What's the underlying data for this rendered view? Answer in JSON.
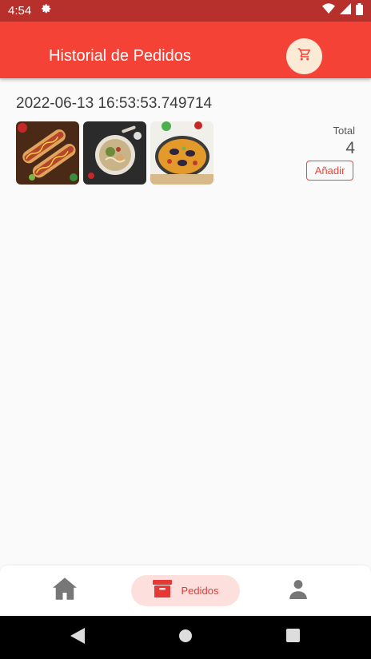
{
  "status_bar": {
    "time": "4:54",
    "icons": [
      "settings-icon",
      "wifi-icon",
      "cell-signal-icon",
      "battery-icon"
    ]
  },
  "app_bar": {
    "title": "Historial de Pedidos",
    "cart_icon": "cart-icon",
    "colors": {
      "background": "#f44336",
      "cart_button": "#fbead6"
    }
  },
  "orders": [
    {
      "date": "2022-06-13 16:53:53.749714",
      "images": [
        "hot-dogs-photo",
        "noodle-soup-photo",
        "paella-photo"
      ],
      "total_label": "Total",
      "total_value": "4",
      "add_label": "Añadir"
    }
  ],
  "bottom_nav": {
    "items": [
      {
        "icon": "home-icon",
        "label": ""
      },
      {
        "icon": "archive-box-icon",
        "label": "Pedidos",
        "active": true
      },
      {
        "icon": "person-icon",
        "label": ""
      }
    ],
    "active_color": "#e53935"
  },
  "system_nav": {
    "icons": [
      "back-icon",
      "home-circle-icon",
      "recents-icon"
    ]
  }
}
